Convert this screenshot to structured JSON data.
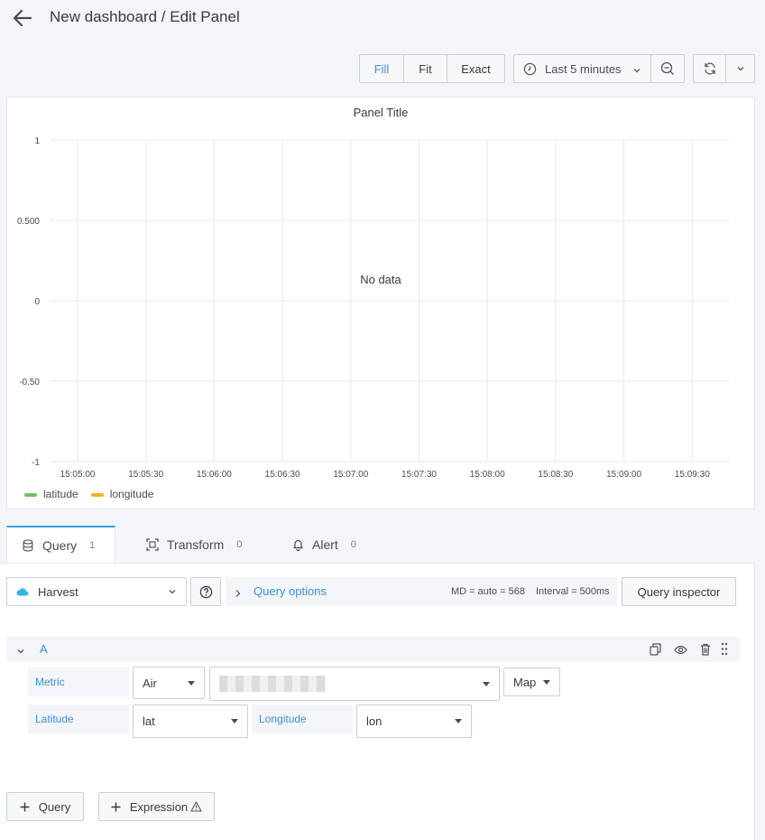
{
  "header": {
    "breadcrumb": "New dashboard / Edit Panel"
  },
  "toolbar": {
    "fill_label": "Fill",
    "fit_label": "Fit",
    "exact_label": "Exact",
    "time_range": "Last 5 minutes"
  },
  "panel": {
    "title": "Panel Title",
    "no_data": "No data",
    "legend": [
      {
        "name": "latitude",
        "color": "#73bf69"
      },
      {
        "name": "longitude",
        "color": "#f2b01e"
      }
    ]
  },
  "chart_data": {
    "type": "line",
    "title": "Panel Title",
    "x_ticks": [
      "15:05:00",
      "15:05:30",
      "15:06:00",
      "15:06:30",
      "15:07:00",
      "15:07:30",
      "15:08:00",
      "15:08:30",
      "15:09:00",
      "15:09:30"
    ],
    "y_ticks": [
      "1",
      "0.500",
      "0",
      "-0.50",
      "-1"
    ],
    "ylim": [
      -1,
      1
    ],
    "series": [
      {
        "name": "latitude",
        "values": []
      },
      {
        "name": "longitude",
        "values": []
      }
    ],
    "grid": true,
    "legend_position": "bottom-left"
  },
  "tabs": [
    {
      "label": "Query",
      "count": "1"
    },
    {
      "label": "Transform",
      "count": "0"
    },
    {
      "label": "Alert",
      "count": "0"
    }
  ],
  "query_bar": {
    "datasource": "Harvest",
    "query_options": "Query options",
    "md": "MD = auto = 568",
    "interval": "Interval = 500ms",
    "inspector": "Query inspector"
  },
  "query": {
    "ref_id": "A",
    "metric_label": "Metric",
    "metric_type": "Air",
    "metric_mode": "Map",
    "latitude_label": "Latitude",
    "latitude_value": "lat",
    "longitude_label": "Longitude",
    "longitude_value": "lon"
  },
  "footer": {
    "add_query": "Query",
    "add_expression": "Expression"
  }
}
